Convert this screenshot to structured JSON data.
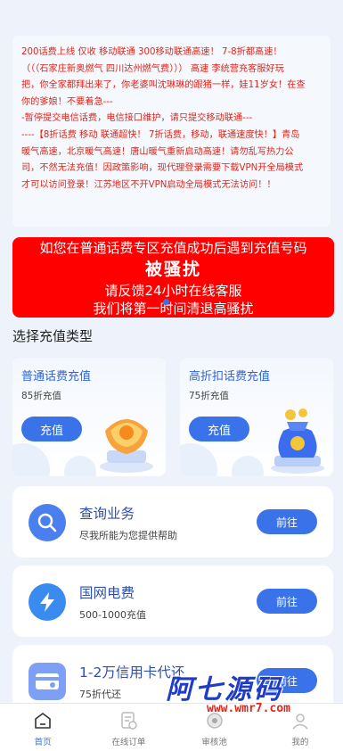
{
  "notice": {
    "lines": [
      "200话费上线 仅收 移动联通 300移动联通高速！ 7-8折都高速！",
      "（（（石家庄新奥燃气 四川达州燃气费））） 高速 李统营充客服好玩",
      "把，你全家都拜出来了，你老婆叫沈琳琳的跟猪一样，娃11岁女！在查",
      "你的爹娘！不要着急---",
      "-暂停提交电信话费，电信接口维护，请只提交移动联通---",
      "----【8折话费 移动 联通超快！ 7折话费，移动，联通速度快！】青岛",
      "暖气高速，北京暖气高速！唐山暖气重新启动高速！请勿乱写热力公",
      "司，不然无法充值！因政策影响，现代理登录需要下载VPN开全局模式",
      "才可以访问登录！江苏地区不开VPN启动全局模式无法访问！！"
    ]
  },
  "banner": {
    "line1": "如您在普通话费专区充值成功后遇到充值号码",
    "line2": "被骚扰",
    "line3": "请反馈24小时在线客服",
    "line4": "我们将第一时间清退高骚扰"
  },
  "section_title": "选择充值类型",
  "recharge_cards": [
    {
      "title": "普通话费充值",
      "sub": "85折充值",
      "button": "充值"
    },
    {
      "title": "高折扣话费充值",
      "sub": "75折充值",
      "button": "充值"
    }
  ],
  "services": [
    {
      "name": "查询业务",
      "desc": "尽我所能为您提供帮助",
      "button": "前往",
      "icon": "search-icon",
      "color": "#4a7ff0"
    },
    {
      "name": "国网电费",
      "desc": "500-1000充值",
      "button": "前往",
      "icon": "lightning-icon",
      "color": "#3a8bf0"
    },
    {
      "name": "1-2万信用卡代还",
      "desc": "75折代还",
      "button": "前往",
      "icon": "credit-card-icon",
      "color": "#7d9ff5"
    }
  ],
  "tabs": [
    {
      "label": "首页",
      "icon": "home-icon"
    },
    {
      "label": "在线订单",
      "icon": "order-icon"
    },
    {
      "label": "审核池",
      "icon": "audit-icon"
    },
    {
      "label": "我的",
      "icon": "profile-icon"
    }
  ],
  "watermark": {
    "text": "阿七源码",
    "url": "www.wmr7.com"
  }
}
